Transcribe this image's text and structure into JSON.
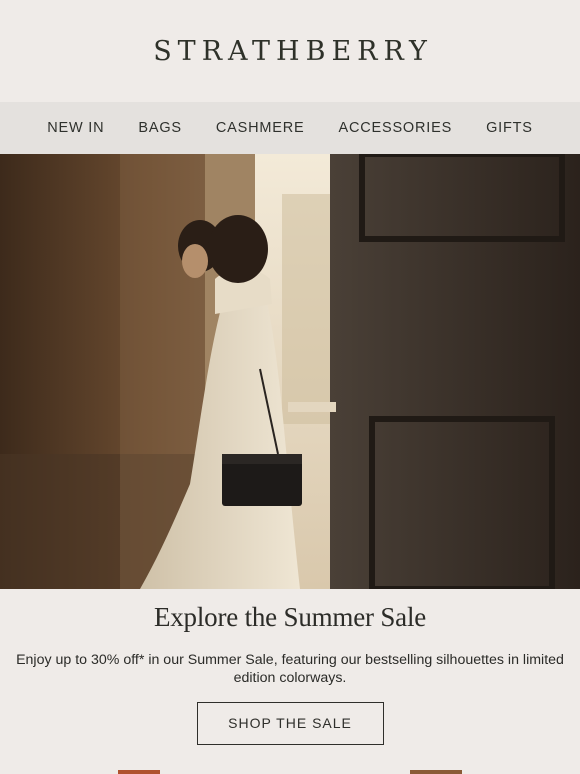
{
  "brand": {
    "logo_text": "STRATHBERRY"
  },
  "nav": {
    "items": [
      {
        "label": "NEW IN"
      },
      {
        "label": "BAGS"
      },
      {
        "label": "CASHMERE"
      },
      {
        "label": "ACCESSORIES"
      },
      {
        "label": "GIFTS"
      }
    ]
  },
  "hero": {
    "image": "woman-in-white-dress-with-black-handbag-photo"
  },
  "promo": {
    "title": "Explore the Summer Sale",
    "body": "Enjoy up to 30% off* in our Summer Sale, featuring our bestselling silhouettes in limited edition colorways.",
    "cta_label": "SHOP THE SALE"
  },
  "colors": {
    "background": "#efebe8",
    "nav_background": "#e4e1de",
    "text": "#2c2c28"
  }
}
